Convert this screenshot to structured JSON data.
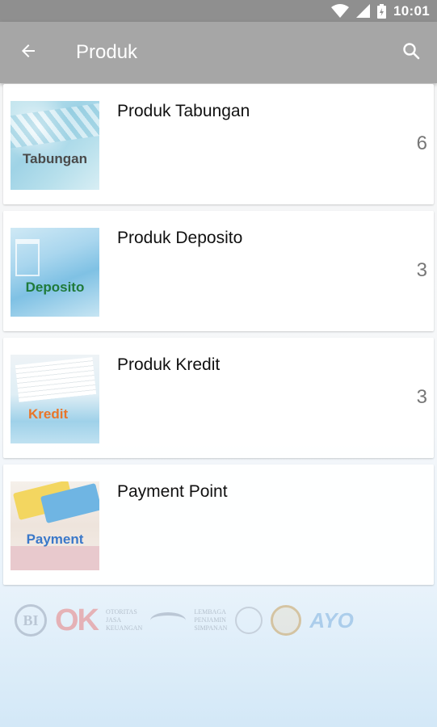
{
  "status_bar": {
    "time": "10:01",
    "icons": [
      "wifi-icon",
      "signal-icon",
      "battery-icon"
    ]
  },
  "app_bar": {
    "title": "Produk",
    "back_icon": "arrow-left-icon",
    "search_icon": "search-icon",
    "background": "#a6a6a6"
  },
  "products": [
    {
      "name": "Produk Tabungan",
      "count": "6",
      "thumb_label": "Tabungan",
      "thumb_label_color": "#4a4a4a"
    },
    {
      "name": "Produk Deposito",
      "count": "3",
      "thumb_label": "Deposito",
      "thumb_label_color": "#1f7a3a"
    },
    {
      "name": "Produk Kredit",
      "count": "3",
      "thumb_label": "Kredit",
      "thumb_label_color": "#e8762a"
    },
    {
      "name": "Payment Point",
      "count": "",
      "thumb_label": "Payment",
      "thumb_label_color": "#3a78c9"
    }
  ],
  "footer_logos": {
    "bi": "BI",
    "ojk": "OK",
    "ojk_text": [
      "OTORITAS",
      "JASA",
      "KEUANGAN"
    ],
    "lps_text": [
      "LEMBAGA",
      "PENJAMIN",
      "SIMPANAN"
    ],
    "ayo": "AYO"
  }
}
